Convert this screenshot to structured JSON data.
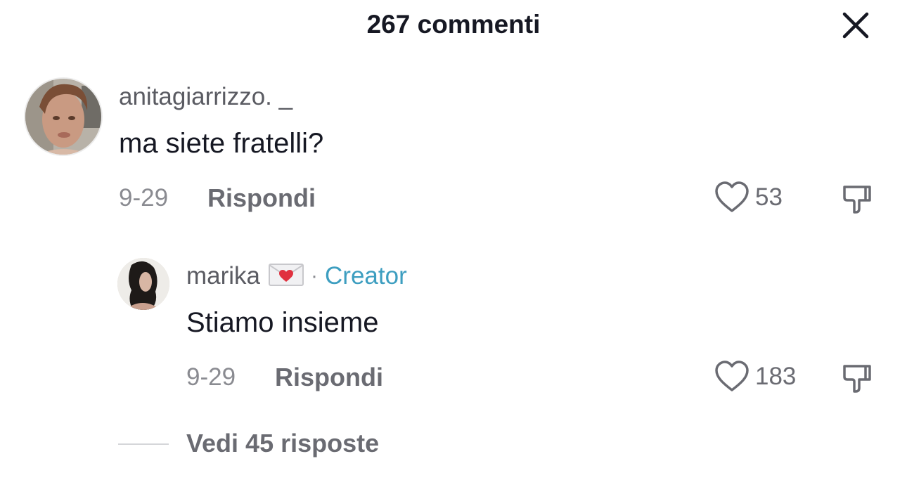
{
  "header": {
    "title": "267 commenti",
    "close_icon": "close-icon"
  },
  "comments": [
    {
      "username": "anitagiarrizzo. _",
      "text": "ma siete fratelli?",
      "date": "9-29",
      "reply_label": "Rispondi",
      "likes": "53",
      "like_icon": "heart-outline-icon",
      "dislike_icon": "thumbs-down-icon"
    }
  ],
  "reply": {
    "username": "marika",
    "emoji_icon": "love-letter-envelope-icon",
    "separator": "·",
    "badge": "Creator",
    "badge_color": "#3d9ec0",
    "text": "Stiamo insieme",
    "date": "9-29",
    "reply_label": "Rispondi",
    "likes": "183",
    "like_icon": "heart-outline-icon",
    "dislike_icon": "thumbs-down-icon"
  },
  "view_replies": "Vedi 45 risposte"
}
